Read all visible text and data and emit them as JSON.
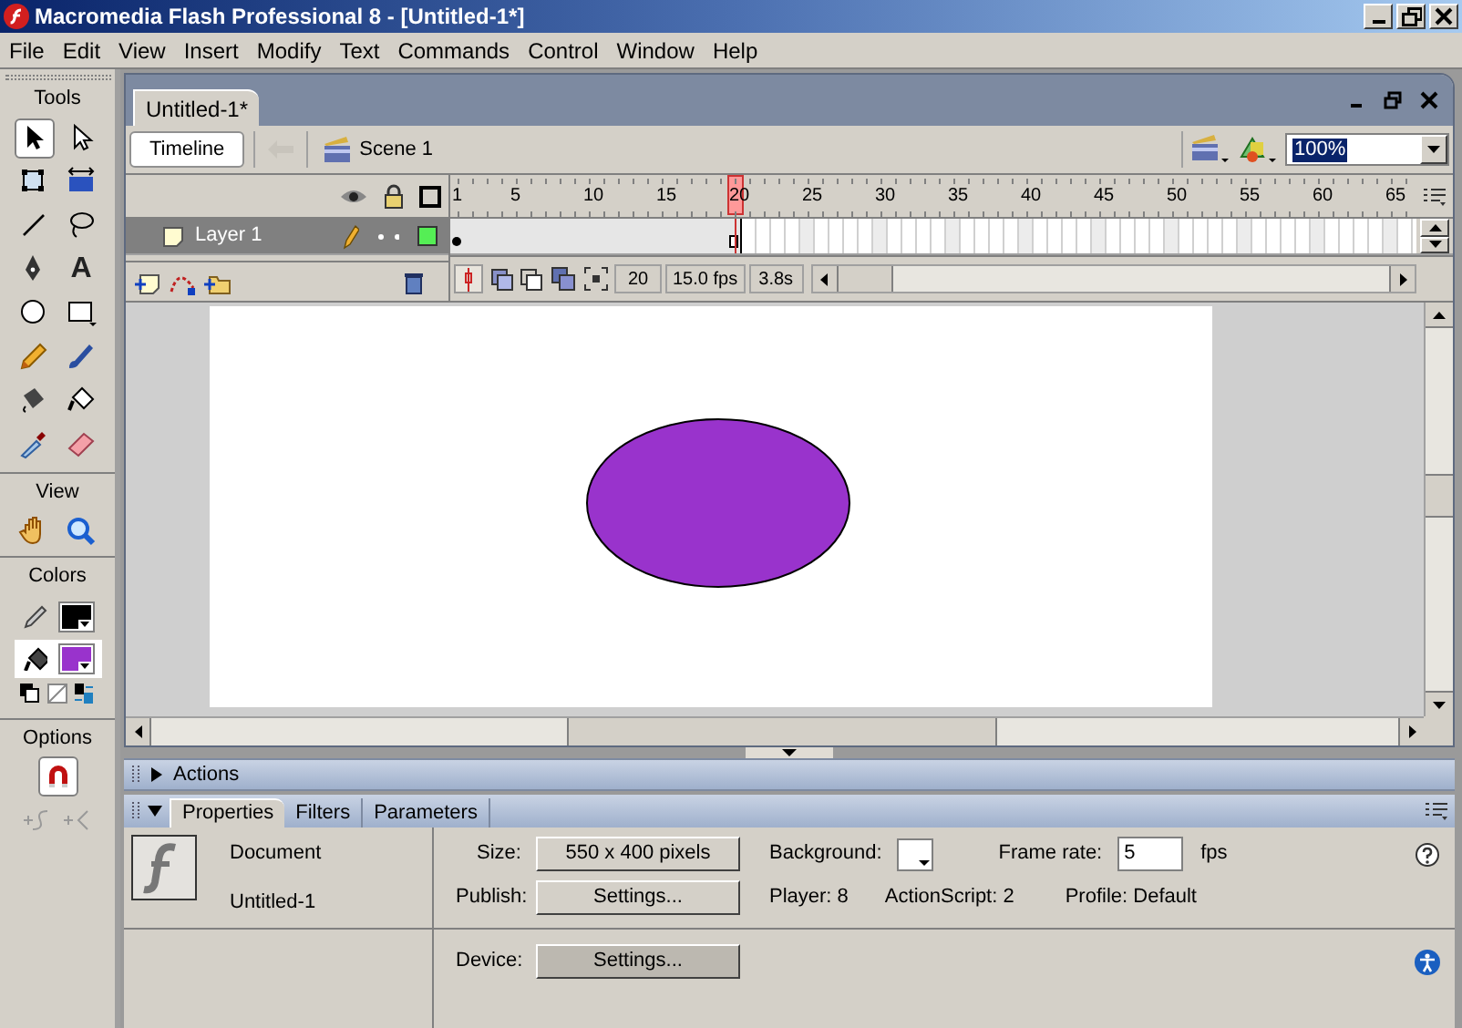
{
  "window": {
    "title": "Macromedia Flash Professional 8 - [Untitled-1*]"
  },
  "menu": [
    "File",
    "Edit",
    "View",
    "Insert",
    "Modify",
    "Text",
    "Commands",
    "Control",
    "Window",
    "Help"
  ],
  "tools_panel": {
    "title": "Tools",
    "tools": [
      {
        "kind": "arrow",
        "selected": true
      },
      {
        "kind": "subselect",
        "selected": false
      },
      {
        "kind": "transform",
        "selected": false
      },
      {
        "kind": "gradient",
        "selected": false
      },
      {
        "kind": "line",
        "selected": false
      },
      {
        "kind": "lasso",
        "selected": false
      },
      {
        "kind": "pen",
        "selected": false
      },
      {
        "kind": "text",
        "glyph": "A",
        "selected": false
      },
      {
        "kind": "oval",
        "selected": false
      },
      {
        "kind": "rectangle",
        "selected": false
      },
      {
        "kind": "pencil",
        "selected": false
      },
      {
        "kind": "brush",
        "selected": false
      },
      {
        "kind": "inkbottle",
        "selected": false
      },
      {
        "kind": "bucket",
        "selected": false
      },
      {
        "kind": "eyedropper",
        "selected": false
      },
      {
        "kind": "eraser",
        "selected": false
      }
    ]
  },
  "view_panel": {
    "title": "View",
    "tools": [
      {
        "kind": "hand",
        "selected": false
      },
      {
        "kind": "zoom",
        "selected": false
      }
    ]
  },
  "colors_panel": {
    "title": "Colors",
    "fill_selected": true
  },
  "options_panel": {
    "title": "Options",
    "snap_on": true
  },
  "document": {
    "tab": "Untitled-1*",
    "timeline_button": "Timeline",
    "scene": "Scene 1",
    "zoom": "100%"
  },
  "timeline": {
    "ruler": [
      "1",
      "5",
      "10",
      "15",
      "20",
      "25",
      "30",
      "35",
      "40",
      "45",
      "50",
      "55",
      "60",
      "65"
    ],
    "layers": [
      {
        "name": "Layer 1",
        "selected": true
      }
    ],
    "current_frame": "20",
    "fps": "15.0 fps",
    "elapsed": "3.8s"
  },
  "stage": {
    "shape": {
      "kind": "ellipse"
    }
  },
  "actions_panel": {
    "title": "Actions",
    "expanded": false
  },
  "properties": {
    "tabs": [
      {
        "label": "Properties",
        "selected": true
      },
      {
        "label": "Filters",
        "selected": false
      },
      {
        "label": "Parameters",
        "selected": false
      }
    ],
    "type": "Document",
    "name": "Untitled-1",
    "size_label": "Size:",
    "size": "550 x 400 pixels",
    "background_label": "Background:",
    "frame_rate_label": "Frame rate:",
    "frame_rate": "5",
    "fps_unit": "fps",
    "publish_label": "Publish:",
    "publish_button": "Settings...",
    "player": "Player: 8",
    "actionscript": "ActionScript: 2",
    "profile": "Profile: Default",
    "device_label": "Device:",
    "device_button": "Settings..."
  }
}
